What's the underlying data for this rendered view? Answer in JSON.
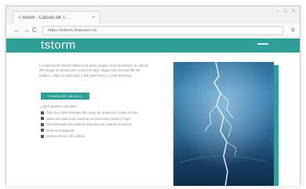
{
  "browser": {
    "tab": {
      "title": "T-Storm - Cálculo de T...",
      "close": "×"
    },
    "window_controls": {
      "minimize": "–",
      "maximize": "□",
      "close": "×"
    },
    "nav": {
      "back": "←",
      "forward": "→",
      "reload": "C"
    },
    "url": "https://tstorm.fedoraen.es",
    "menu": "≡"
  },
  "site": {
    "logo": "tstorm",
    "intro": "La aplicación Tstorm determina paso a paso si es necesario el cálculo del riesgo de protección contra el rayo, según las normas NE 60-0305-2, UNE 21 186:2011 y RD 1997/2011 y UNE 50:2016.",
    "cta": "COMENZAR CÁLCULO",
    "question": "¿Qué quieres calcular?",
    "options": [
      "Cálculo y dimensionado del riesgo de protección contra el rayo",
      "Selección óptima del sistema de protección contra el rayo",
      "Dimensionado del sistema de protección externa e interna",
      "Guía de instalación",
      "Informe técnico del cálculo"
    ],
    "image_alt": "lightning-storm-photo"
  }
}
